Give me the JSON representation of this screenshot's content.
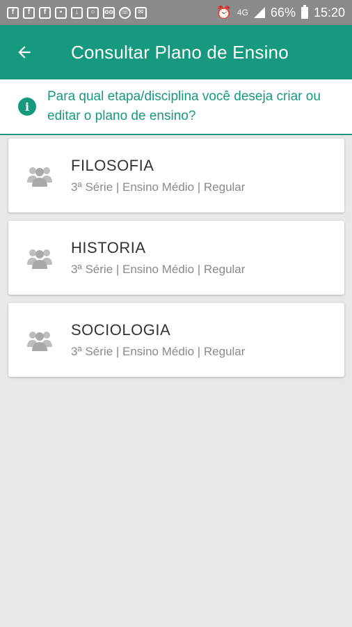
{
  "status_bar": {
    "network": "4G",
    "battery": "66%",
    "time": "15:20"
  },
  "app_bar": {
    "title": "Consultar Plano de Ensino"
  },
  "info_banner": {
    "line1": "Para qual etapa/disciplina você deseja criar ou",
    "line2": "editar o plano de ensino?"
  },
  "subjects": [
    {
      "name": "FILOSOFIA",
      "details": "3ª Série | Ensino Médio | Regular"
    },
    {
      "name": "HISTORIA",
      "details": "3ª Série | Ensino Médio | Regular"
    },
    {
      "name": "SOCIOLOGIA",
      "details": "3ª Série | Ensino Médio | Regular"
    }
  ],
  "colors": {
    "primary": "#16997f",
    "status_bar": "#8a8a8a",
    "background": "#e8e8e8"
  }
}
